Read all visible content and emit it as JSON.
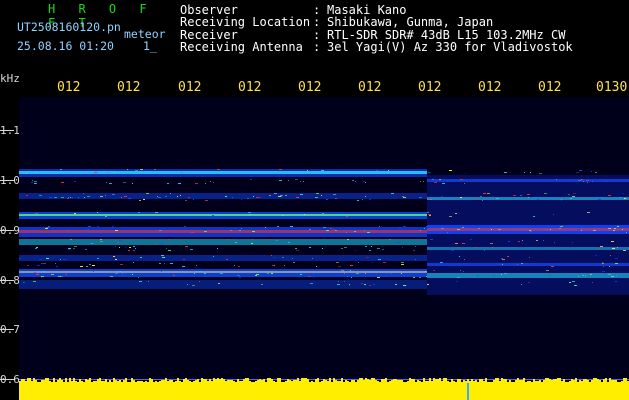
{
  "header": {
    "brand": "H R O F F T",
    "file_name": "UT2508160120.pn",
    "mode": "meteor",
    "datetime": "25.08.16 01:20",
    "count": "1_"
  },
  "meta": [
    {
      "key": "Observer",
      "sep": ":",
      "value": "Masaki Kano"
    },
    {
      "key": "Receiving Location",
      "sep": ":",
      "value": "Shibukawa, Gunma, Japan"
    },
    {
      "key": "Receiver",
      "sep": ":",
      "value": "RTL-SDR SDR# 43dB L15 103.2MHz CW"
    },
    {
      "key": "Receiving Antenna",
      "sep": ":",
      "value": "3el Yagi(V) Az 330 for Vladivostok"
    }
  ],
  "y_axis": {
    "unit": "kHz",
    "ticks": [
      "1.1",
      "1.0",
      "0.9",
      "0.8",
      "0.7",
      "0.6"
    ]
  },
  "x_axis": {
    "ticks": [
      "012",
      "012",
      "012",
      "012",
      "012",
      "012",
      "012",
      "012",
      "012",
      "0130"
    ]
  },
  "colors": {
    "brand": "#19d919",
    "file_info": "#8fd1ff",
    "time_labels": "#ffe14d",
    "background": "#000014",
    "amplitude": "#ffff00"
  }
}
